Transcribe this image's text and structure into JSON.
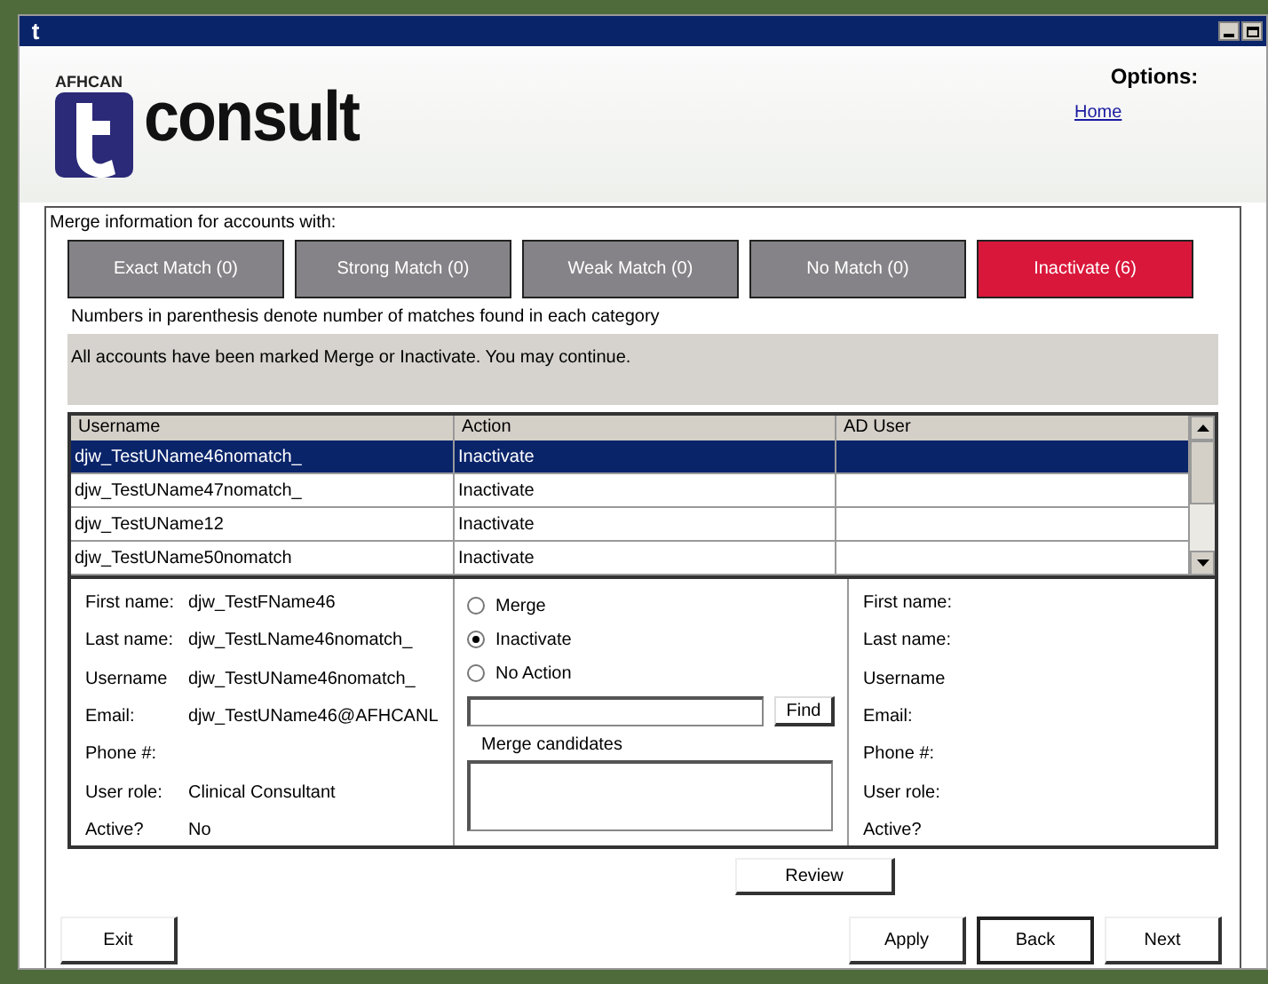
{
  "window": {
    "title_icon": "t"
  },
  "header": {
    "logo_small": "AFHCAN",
    "logo_text": "consult",
    "options_title": "Options:",
    "options_links": [
      "Home"
    ]
  },
  "merge": {
    "label": "Merge information for accounts with:",
    "categories": [
      {
        "label": "Exact Match (0)",
        "selected": false
      },
      {
        "label": "Strong Match (0)",
        "selected": false
      },
      {
        "label": "Weak Match (0)",
        "selected": false
      },
      {
        "label": "No Match (0)",
        "selected": false
      },
      {
        "label": "Inactivate (6)",
        "selected": true
      }
    ],
    "note": "Numbers in parenthesis denote number of matches found in each category",
    "message": "All accounts have been marked Merge or Inactivate.  You may continue."
  },
  "table": {
    "columns": [
      "Username",
      "Action",
      "AD User"
    ],
    "rows": [
      {
        "cells": [
          "djw_TestUName46nomatch_",
          "Inactivate"
        ],
        "selected": true
      },
      {
        "cells": [
          "djw_TestUName47nomatch_",
          "Inactivate"
        ],
        "selected": false
      },
      {
        "cells": [
          "djw_TestUName12",
          "Inactivate"
        ],
        "selected": false
      },
      {
        "cells": [
          "djw_TestUName50nomatch",
          "Inactivate"
        ],
        "selected": false
      }
    ]
  },
  "details": {
    "left": [
      {
        "label": "First name:",
        "value": "djw_TestFName46"
      },
      {
        "label": "Last name:",
        "value": "djw_TestLName46nomatch_"
      },
      {
        "label": "Username",
        "value": "djw_TestUName46nomatch_"
      },
      {
        "label": "Email:",
        "value": "djw_TestUName46@AFHCANL"
      },
      {
        "label": "Phone #:"
      },
      {
        "label": "User role:",
        "value": "Clinical Consultant"
      },
      {
        "label": "Active?",
        "value": "No"
      }
    ],
    "actions": [
      {
        "label": "Merge",
        "selected": false
      },
      {
        "label": "Inactivate",
        "selected": true
      },
      {
        "label": "No Action",
        "selected": false
      }
    ],
    "find_button": "Find",
    "candidates_label": "Merge candidates",
    "right": [
      {
        "label": "First name:"
      },
      {
        "label": "Last name:"
      },
      {
        "label": "Username"
      },
      {
        "label": "Email:"
      },
      {
        "label": "Phone #:"
      },
      {
        "label": "User role:"
      },
      {
        "label": "Active?"
      }
    ]
  },
  "buttons": {
    "review": "Review",
    "exit": "Exit",
    "apply": "Apply",
    "back": "Back",
    "next": "Next"
  }
}
